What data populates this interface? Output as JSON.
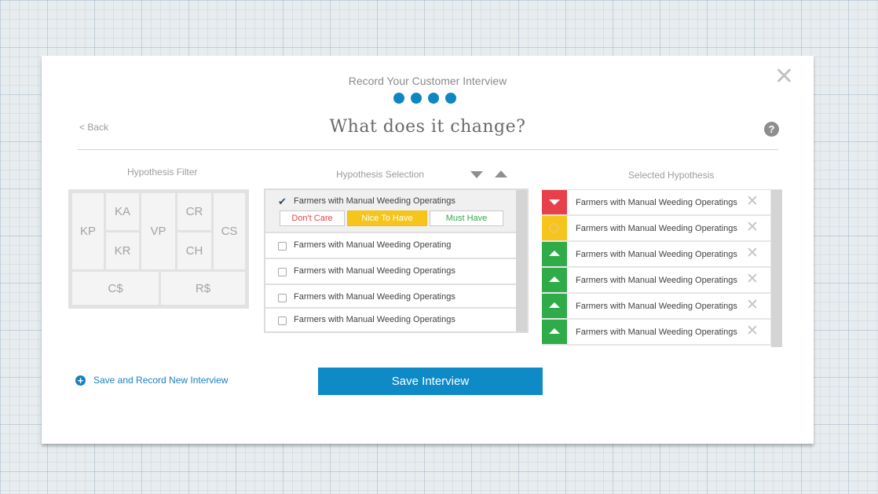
{
  "header": {
    "title": "Record Your Customer Interview",
    "progress_steps": 4,
    "close_glyph": "✕",
    "back_label": "< Back",
    "main_title": "What does it change?",
    "help_glyph": "?"
  },
  "filter": {
    "label": "Hypothesis Filter",
    "cells": {
      "kp": "KP",
      "ka": "KA",
      "kr": "KR",
      "vp": "VP",
      "cr": "CR",
      "ch": "CH",
      "cs": "CS",
      "cost": "C$",
      "revenue": "R$"
    }
  },
  "selection": {
    "label": "Hypothesis Selection",
    "items": [
      {
        "label": "Farmers with Manual Weeding Operatings",
        "checked": true
      },
      {
        "label": "Farmers with Manual Weeding Operating",
        "checked": false
      },
      {
        "label": "Farmers with Manual Weeding Operatings",
        "checked": false
      },
      {
        "label": "Farmers with Manual Weeding Operatings",
        "checked": false
      },
      {
        "label": "Farmers with Manual Weeding Operatings",
        "checked": false
      }
    ],
    "rating": {
      "dont_care": "Don't Care",
      "nice_to_have": "Nice To Have",
      "must_have": "Must Have"
    }
  },
  "selected": {
    "label": "Selected Hypothesis",
    "rows": [
      {
        "label": "Farmers with Manual Weeding Operatings",
        "rating": "dont-care"
      },
      {
        "label": "Farmers with Manual Weeding Operatings",
        "rating": "nice-to-have"
      },
      {
        "label": "Farmers with Manual Weeding Operatings",
        "rating": "must-have"
      },
      {
        "label": "Farmers with Manual Weeding Operatings",
        "rating": "must-have"
      },
      {
        "label": "Farmers with Manual Weeding Operatings",
        "rating": "must-have"
      },
      {
        "label": "Farmers with Manual Weeding Operatings",
        "rating": "must-have"
      }
    ],
    "remove_glyph": "✕"
  },
  "footer": {
    "save_new_label": "Save and Record New Interview",
    "save_label": "Save Interview",
    "plus_glyph": "+"
  },
  "colors": {
    "accent": "#0e8ac7",
    "dont_care": "#e8404a",
    "nice_to_have": "#f6c51b",
    "must_have": "#2fab4a"
  }
}
